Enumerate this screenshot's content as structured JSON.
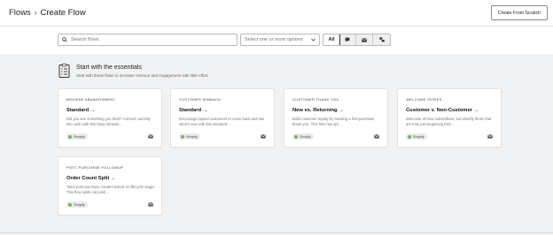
{
  "header": {
    "breadcrumb_root": "Flows",
    "breadcrumb_separator": "›",
    "breadcrumb_current": "Create Flow",
    "create_button_label": "Create From Scratch"
  },
  "filters": {
    "search_placeholder": "Search flows",
    "select_placeholder": "Select one or more options",
    "channels": [
      {
        "label": "All",
        "icon": "",
        "selected": true
      },
      {
        "label": "",
        "icon": "chat-bubble-icon",
        "selected": false
      },
      {
        "label": "",
        "icon": "email-icon",
        "selected": false
      },
      {
        "label": "",
        "icon": "multi-channel-icon",
        "selected": false
      }
    ]
  },
  "section": {
    "icon": "checklist-icon",
    "title": "Start with the essentials",
    "subtitle": "Start with these flows to increase revenue and engagement with little effort."
  },
  "cards": [
    {
      "category": "BROWSE ABANDONMENT",
      "name": "Standard",
      "arrow": "→",
      "description": "Did you see something you liked? Convert curiosity into cash with this basic Browse…",
      "badge": "Shopify",
      "channel_icon": "email-icon"
    },
    {
      "category": "CUSTOMER WINBACK",
      "name": "Standard",
      "arrow": "→",
      "description": "Encourage lapsed customers to come back and see what's new with this standard…",
      "badge": "Shopify",
      "channel_icon": "email-icon"
    },
    {
      "category": "CUSTOMER THANK YOU",
      "name": "New vs. Returning",
      "arrow": "→",
      "description": "Build customer loyalty by sending a first-purchase thank-you. This flow has spl…",
      "badge": "Shopify",
      "channel_icon": "email-icon"
    },
    {
      "category": "WELCOME SERIES",
      "name": "Customer v. Non-Customer",
      "arrow": "→",
      "description": "Welcome all new subscribers, but identify those that are truly just beginning their…",
      "badge": "Shopify",
      "channel_icon": "email-icon"
    },
    {
      "category": "POST-PURCHASE FOLLOWUP",
      "name": "Order Count Split",
      "arrow": "→",
      "description": "Tailor post-purchase content based on lifecycle stage! This flow splits out posit…",
      "badge": "Shopify",
      "channel_icon": "email-icon"
    }
  ],
  "colors": {
    "page_background": "#f1f2f3",
    "shopify_green": "#7ab55c",
    "border": "#b9b9b9"
  }
}
